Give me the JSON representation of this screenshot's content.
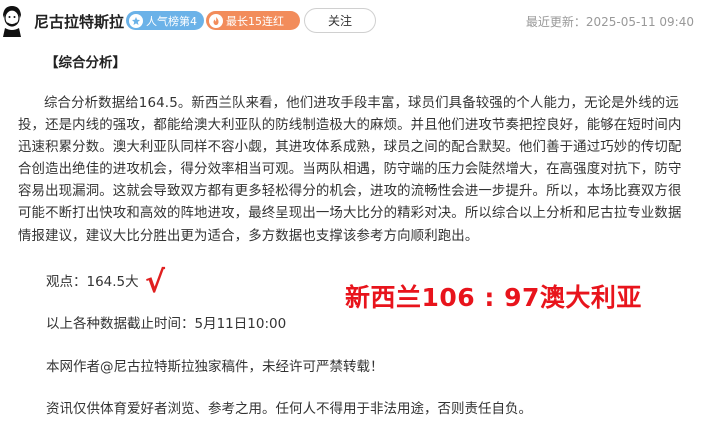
{
  "header": {
    "author_name": "尼古拉特斯拉",
    "badge_popularity": "人气榜第4",
    "badge_streak": "最长15连红",
    "follow_label": "关注",
    "updated": "最近更新：2025-05-11 09:40"
  },
  "article": {
    "section_title": "【综合分析】",
    "paragraph": "综合分析数据给164.5。新西兰队来看，他们进攻手段丰富，球员们具备较强的个人能力，无论是外线的远投，还是内线的强攻，都能给澳大利亚队的防线制造极大的麻烦。并且他们进攻节奏把控良好，能够在短时间内迅速积累分数。澳大利亚队同样不容小觑，其进攻体系成熟，球员之间的配合默契。他们善于通过巧妙的传切配合创造出绝佳的进攻机会，得分效率相当可观。当两队相遇，防守端的压力会陡然增大，在高强度对抗下，防守容易出现漏洞。这就会导致双方都有更多轻松得分的机会，进攻的流畅性会进一步提升。所以，本场比赛双方很可能不断打出快攻和高效的阵地进攻，最终呈现出一场大比分的精彩对决。所以综合以上分析和尼古拉专业数据情报建议，建议大比分胜出更为适合，多方数据也支撑该参考方向顺利跑出。",
    "viewpoint": "观点：164.5大",
    "check_mark": "√",
    "score": "新西兰106 : 97澳大利亚",
    "deadline": "以上各种数据截止时间：5月11日10:00",
    "copyright": "本网作者@尼古拉特斯拉独家稿件，未经许可严禁转载！",
    "disclaimer": "资讯仅供体育爱好者浏览、参考之用。任何人不得用于非法用途，否则责任自负。"
  },
  "colors": {
    "badge_popularity": "#6bb2e8",
    "badge_streak": "#f28c5b",
    "highlight_red": "#e8141c"
  },
  "icons": {
    "avatar": "author-portrait",
    "badge_popularity_icon": "rank-icon",
    "badge_streak_icon": "flame-icon"
  }
}
